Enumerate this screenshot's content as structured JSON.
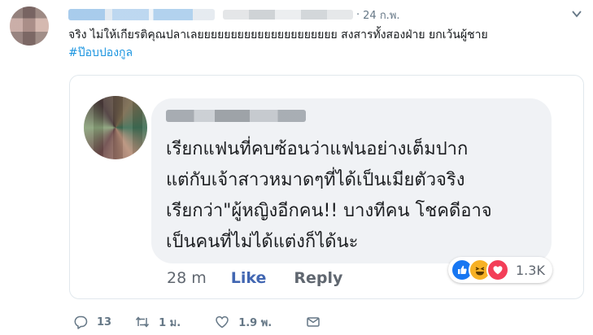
{
  "tweet": {
    "dot": "·",
    "date": "24 ก.พ.",
    "text": "จริง ไม่ให้เกียรติคุณปลาเลยยยยยยยยยยยยยยยยยยยยย สงสารทั้งสองฝ่าย ยกเว้นผู้ชาย",
    "hashtag": "#ป๊อบปองกูล"
  },
  "embedded_comment": {
    "lines": [
      "เรียกแฟนที่คบซ้อนว่าแฟนอย่างเต็มปาก",
      "แต่กับเจ้าสาวหมาดๆที่ได้เป็นเมียตัวจริง",
      "เรียกว่า\"ผู้หญิงอีกคน!! บางทีคน โชคดีอาจ",
      "เป็นคนที่ไม่ได้แต่งก็ได้นะ"
    ],
    "time": "28 m",
    "like_label": "Like",
    "reply_label": "Reply",
    "reaction_count": "1.3K",
    "reaction_icons": [
      "like-icon",
      "haha-icon",
      "love-icon"
    ],
    "colors": {
      "like": "#1877f2",
      "haha": "#f7b125",
      "love": "#f33e58"
    }
  },
  "actions": {
    "reply_count": "13",
    "retweet_count": "1 ม.",
    "like_count": "1.9 พ."
  },
  "colors": {
    "accent": "#1b95e0",
    "fb_blue": "#4267b2",
    "muted": "#657786"
  }
}
